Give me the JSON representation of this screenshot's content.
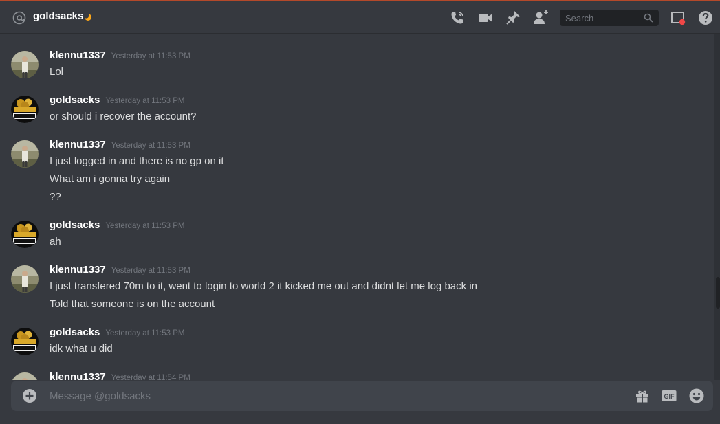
{
  "header": {
    "recipient": "goldsacks",
    "status": "idle",
    "search_placeholder": "Search"
  },
  "messages": [
    {
      "author": "klennu1337",
      "time": "Yesterday at 11:53 PM",
      "avatar": "person-photo-avatar",
      "lines": [
        "Lol"
      ]
    },
    {
      "author": "goldsacks",
      "time": "Yesterday at 11:53 PM",
      "avatar": "gold-sacks-logo-avatar",
      "lines": [
        "or should i recover the account?"
      ]
    },
    {
      "author": "klennu1337",
      "time": "Yesterday at 11:53 PM",
      "avatar": "person-photo-avatar",
      "lines": [
        "I just logged in and there is no gp on it",
        "What am i gonna try again",
        "??"
      ]
    },
    {
      "author": "goldsacks",
      "time": "Yesterday at 11:53 PM",
      "avatar": "gold-sacks-logo-avatar",
      "lines": [
        "ah"
      ]
    },
    {
      "author": "klennu1337",
      "time": "Yesterday at 11:53 PM",
      "avatar": "person-photo-avatar",
      "lines": [
        "I just transfered 70m to it, went to login to world 2 it kicked me out and didnt let me log back in",
        "Told that someone is on the account"
      ]
    },
    {
      "author": "goldsacks",
      "time": "Yesterday at 11:53 PM",
      "avatar": "gold-sacks-logo-avatar",
      "lines": [
        "idk what u did"
      ]
    },
    {
      "author": "klennu1337",
      "time": "Yesterday at 11:54 PM",
      "avatar": "person-photo-avatar",
      "lines": []
    }
  ],
  "composer": {
    "placeholder": "Message @goldsacks"
  },
  "colors": {
    "background": "#36393f",
    "input_background": "#40444b",
    "accent_top": "#b4492a",
    "idle_status": "#faa61a",
    "notification_dot": "#f04747"
  }
}
